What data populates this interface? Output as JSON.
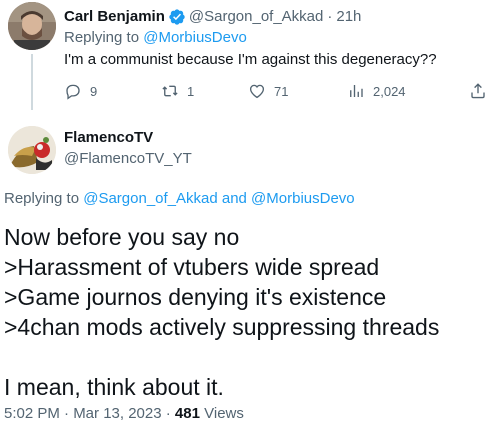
{
  "reply_tweet": {
    "author_name": "Carl Benjamin",
    "handle": "@Sargon_of_Akkad",
    "separator": "·",
    "time": "21h",
    "replying_prefix": "Replying to",
    "replying_to": "@MorbiusDevo",
    "text": "I'm a communist because I'm against this degeneracy??",
    "actions": {
      "replies": "9",
      "retweets": "1",
      "likes": "71",
      "views": "2,024"
    }
  },
  "main_tweet": {
    "author_name": "FlamencoTV",
    "handle": "@FlamencoTV_YT",
    "replying_prefix": "Replying to",
    "replying_to": "@Sargon_of_Akkad and @MorbiusDevo",
    "lines": [
      "Now before you say no",
      ">Harassment of vtubers wide spread",
      ">Game journos denying it's existence",
      ">4chan mods actively suppressing threads",
      "",
      "I mean, think about it."
    ],
    "timestamp": "5:02 PM · Mar 13, 2023 ·",
    "views_count": "481",
    "views_label": "Views"
  },
  "colors": {
    "text": "#0f1419",
    "secondary": "#536471",
    "link": "#1d9bf0",
    "verified": "#1d9bf0"
  },
  "icons": [
    "verified-badge-icon",
    "reply-icon",
    "retweet-icon",
    "like-icon",
    "views-icon",
    "share-icon"
  ]
}
